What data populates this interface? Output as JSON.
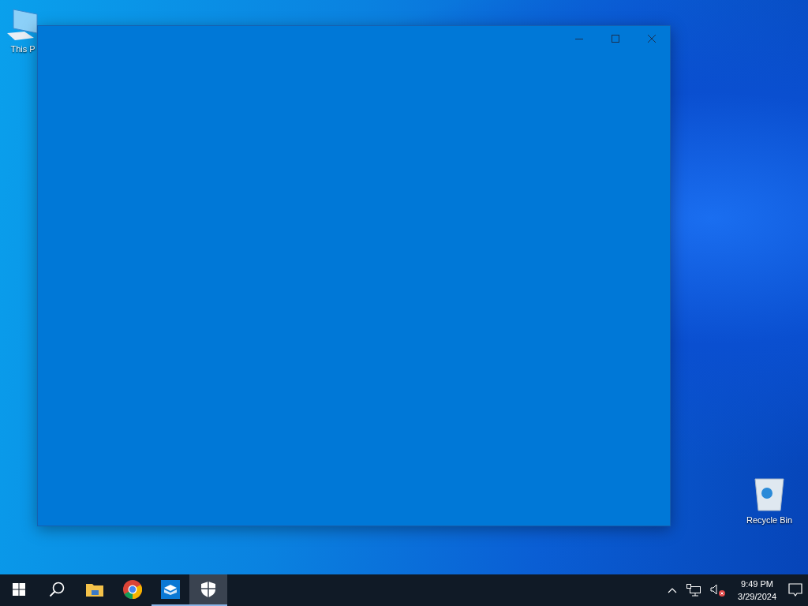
{
  "desktop_icons": [
    {
      "kind": "computer",
      "label": "This P"
    },
    {
      "kind": "recycle",
      "label": "Recycle Bin"
    }
  ],
  "window": {
    "buttons": [
      {
        "kind": "minimize"
      },
      {
        "kind": "maximize"
      },
      {
        "kind": "close"
      }
    ]
  },
  "taskbar": {
    "apps": [
      {
        "kind": "start",
        "running": false,
        "selected": false
      },
      {
        "kind": "search",
        "running": false,
        "selected": false
      },
      {
        "kind": "folder",
        "running": false,
        "selected": false
      },
      {
        "kind": "browser",
        "running": false,
        "selected": false
      },
      {
        "kind": "box",
        "running": true,
        "selected": false
      },
      {
        "kind": "shield",
        "running": true,
        "selected": true
      }
    ],
    "tray": {
      "volume_muted": true,
      "time": "9:49 PM",
      "date": "3/29/2024"
    }
  }
}
